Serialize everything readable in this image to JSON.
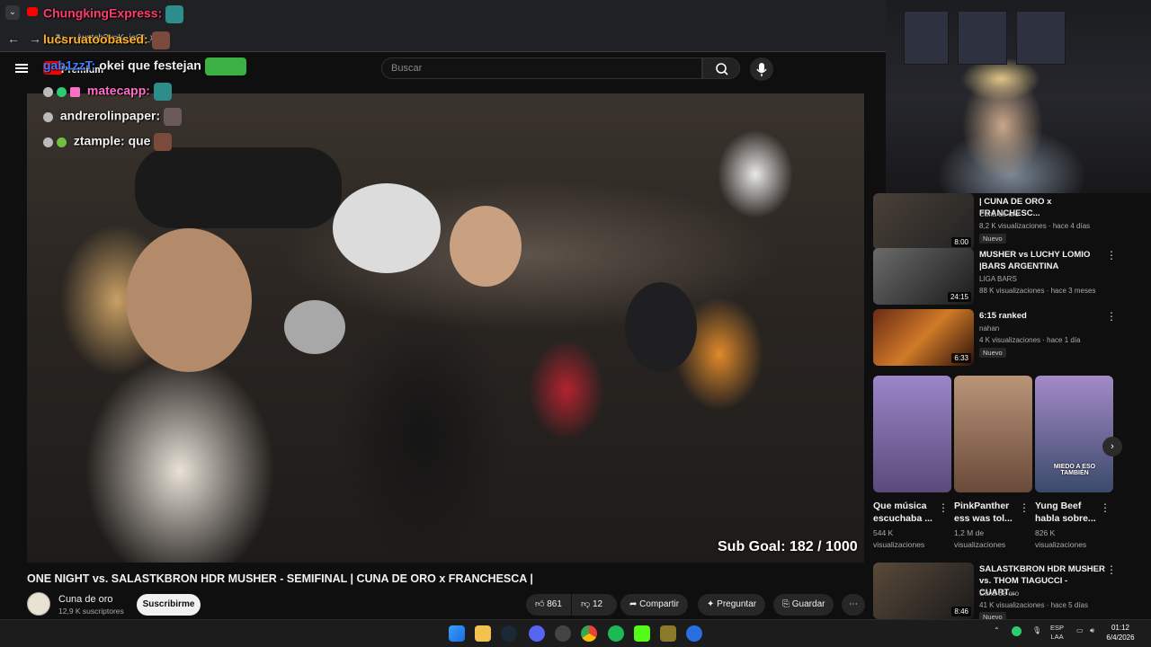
{
  "browser": {
    "url": "/watch?v=K_jcQI_x6-c"
  },
  "header": {
    "logo_label": "Premium",
    "search_placeholder": "Buscar"
  },
  "chat": [
    {
      "user": "ChungkingExpress:",
      "message": "",
      "color": "#ff3b6b"
    },
    {
      "user": "lucsruatoobased:",
      "message": "",
      "color": "#ffb020"
    },
    {
      "user": "gab1zzT:",
      "message": "okei que festejan",
      "color": "#3f7bff"
    },
    {
      "user": "matecapp:",
      "message": "",
      "color": "#ff6ec7"
    },
    {
      "user": "andrerolinpaper:",
      "message": "",
      "color": "#e8e8e8"
    },
    {
      "user": "ztample:",
      "message": "que",
      "color": "#e8e8e8"
    }
  ],
  "video": {
    "overlay": "Sub Goal:  182 / 1000",
    "title": "ONE NIGHT vs. SALASTKBRON HDR MUSHER - SEMIFINAL | CUNA DE ORO x FRANCHESCA |"
  },
  "channel": {
    "name": "Cuna de oro",
    "subscribers": "12,9 K suscriptores",
    "subscribe_label": "Suscribirme"
  },
  "actions": {
    "likes": "861",
    "dislikes": "12",
    "share": "Compartir",
    "ask": "Preguntar",
    "save": "Guardar"
  },
  "sidebar": {
    "videos": [
      {
        "title": "| CUNA DE ORO x FRANCHESC...",
        "channel": "Cuna de oro",
        "meta": "8,2 K visualizaciones · hace 4 días",
        "duration": "8:00",
        "badge": "Nuevo"
      },
      {
        "title": "MUSHER vs LUCHY LOMIO |BARS ARGENTINA",
        "channel": "LIGA BARS",
        "meta": "88 K visualizaciones · hace 3 meses",
        "duration": "24:15",
        "badge": ""
      },
      {
        "title": "6:15 ranked",
        "channel": "nahan",
        "meta": "4 K visualizaciones · hace 1 día",
        "duration": "6:33",
        "badge": "Nuevo"
      }
    ],
    "shorts": [
      {
        "title": "Que música escuchaba ...",
        "views": "544 K visualizaciones"
      },
      {
        "title": "PinkPanther ess was tol...",
        "views": "1,2 M de visualizaciones"
      },
      {
        "title": "Yung Beef habla sobre...",
        "views": "826 K visualizaciones",
        "overlay": "MIEDO A ESO TAMBIÉN"
      }
    ],
    "last_video": {
      "title": "SALASTKBRON HDR MUSHER vs. THOM TIAGUCCI - CUART...",
      "channel": "Cuna de oro",
      "meta": "41 K visualizaciones · hace 5 días",
      "duration": "8:46",
      "badge": "Nuevo"
    }
  },
  "taskbar": {
    "lang_top": "ESP",
    "lang_bottom": "LAA",
    "time": "01:12",
    "date": "6/4/2026"
  }
}
